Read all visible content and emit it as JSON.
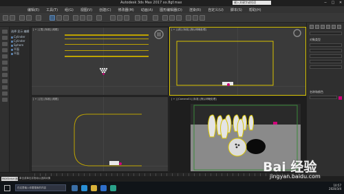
{
  "app": {
    "title": "Autodesk 3ds Max 2017   xx.8gf.max",
    "search_placeholder": "键入关键字或短语",
    "window_controls": [
      "─",
      "□",
      "✕"
    ]
  },
  "menus": [
    "编辑(E)",
    "工具(T)",
    "组(G)",
    "视图(V)",
    "创建(C)",
    "修改器(M)",
    "动画(A)",
    "图形编辑器(D)",
    "渲染(R)",
    "自定义(U)",
    "脚本(S)",
    "帮助(H)"
  ],
  "scene_explorer": {
    "rows": [
      "选择 显示 编辑",
      "Cylinder",
      "Cylinder",
      "Sphere",
      "平面",
      "平面"
    ]
  },
  "viewports": {
    "top": {
      "label": "[ + ] [顶] [标准] [线框]"
    },
    "front": {
      "label": "[ + ] [前] [标准] [默认明暗处理]"
    },
    "left": {
      "label": "[ + ] [左] [标准] [线框]"
    },
    "camera": {
      "label": "[ + ] [Camera01] [标准] [默认明暗处理]"
    }
  },
  "command_panel": {
    "heading_1": "对象类型",
    "heading_2": "名称和颜色",
    "swatch_color": "#d1007a"
  },
  "status": {
    "left_label": "MAXScript 迷你侦",
    "hint": "单击或单击并拖动以选择对象"
  },
  "taskbar": {
    "search_text": "在这里输入你要搜索的内容",
    "time": "10:57",
    "date": "2020/3/4"
  },
  "watermark": {
    "logo": "Bai  经验",
    "url": "jingyan.baidu.com"
  },
  "colors": {
    "selection_yellow": "#d9c400",
    "pin_magenta": "#d1007a"
  }
}
